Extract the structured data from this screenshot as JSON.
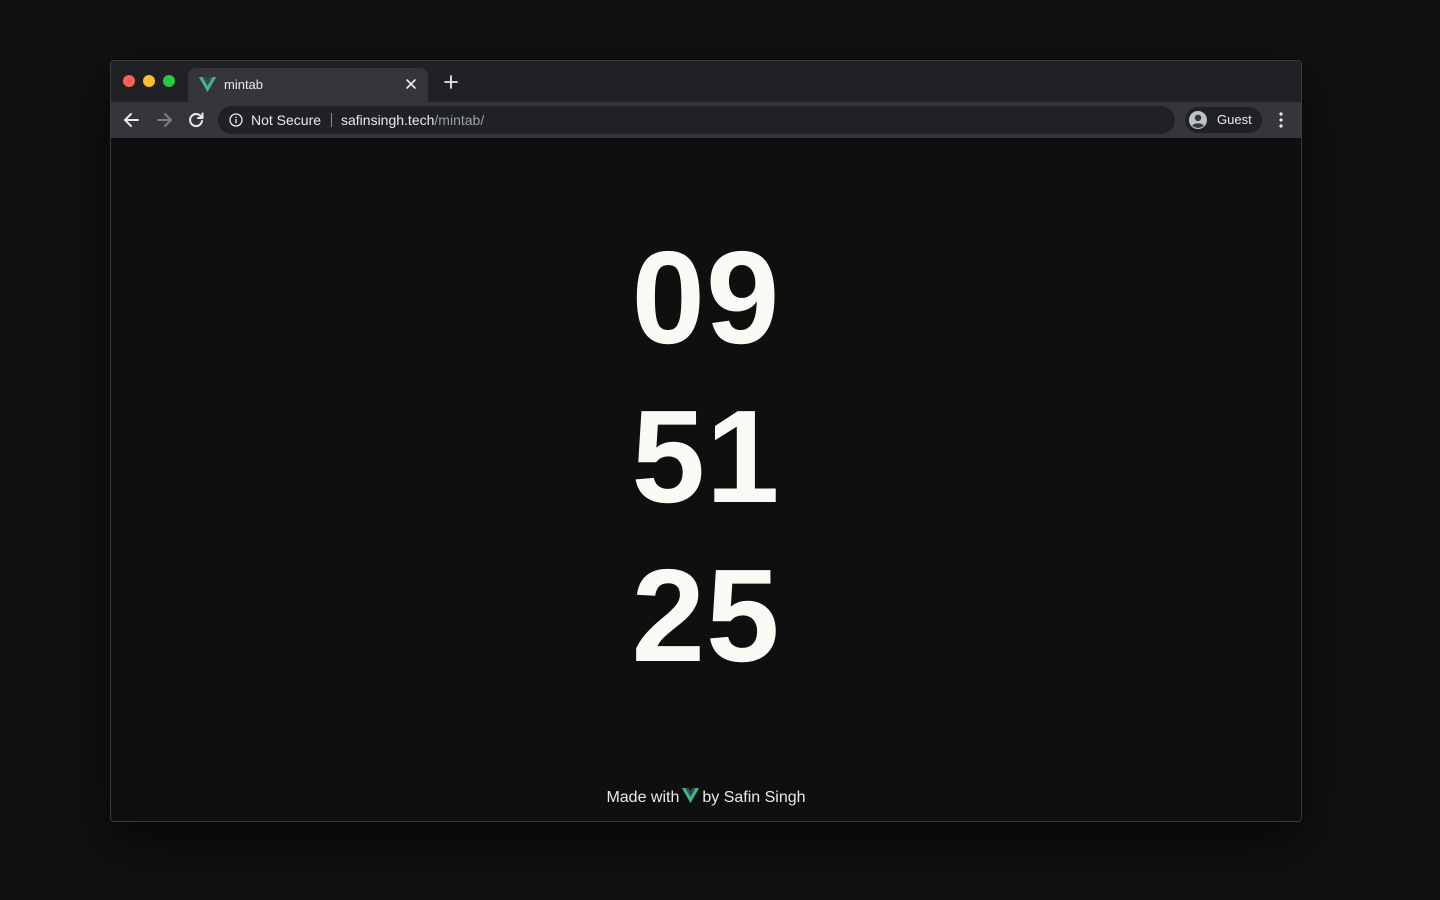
{
  "browser": {
    "tab": {
      "title": "mintab",
      "favicon": "vue-logo-icon",
      "close_icon": "close-icon"
    },
    "new_tab_icon": "plus-icon",
    "toolbar": {
      "back_icon": "arrow-left-icon",
      "forward_icon": "arrow-right-icon",
      "reload_icon": "reload-icon",
      "menu_icon": "kebab-menu-icon"
    },
    "omnibox": {
      "security_label": "Not Secure",
      "url_host": "safinsingh.tech",
      "url_path": "/mintab/"
    },
    "profile": {
      "label": "Guest",
      "avatar_icon": "person-avatar-icon"
    }
  },
  "clock": {
    "hours": "09",
    "minutes": "51",
    "seconds": "25"
  },
  "footer": {
    "prefix": "Made with",
    "logo_icon": "vue-logo-icon",
    "suffix": "by Safin Singh"
  },
  "colors": {
    "desktop_background": "#111111",
    "page_background": "#0f0f0f",
    "clock_text": "#fafaf5",
    "vue_green": "#41b883",
    "vue_dark": "#34495e",
    "tab_bar": "#202124",
    "toolbar": "#35363a"
  }
}
